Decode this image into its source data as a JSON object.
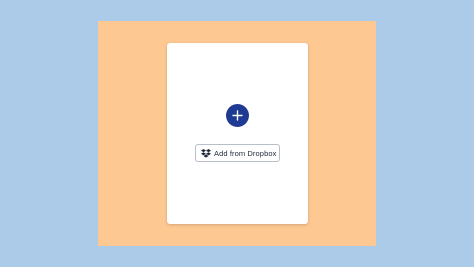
{
  "colors": {
    "background": "#abcbe8",
    "frame": "#fec892",
    "card": "#ffffff",
    "accent": "#1f3a93"
  },
  "upload_card": {
    "add_button_icon": "plus-icon",
    "dropbox_button": {
      "icon": "dropbox-icon",
      "label": "Add from Dropbox"
    }
  }
}
